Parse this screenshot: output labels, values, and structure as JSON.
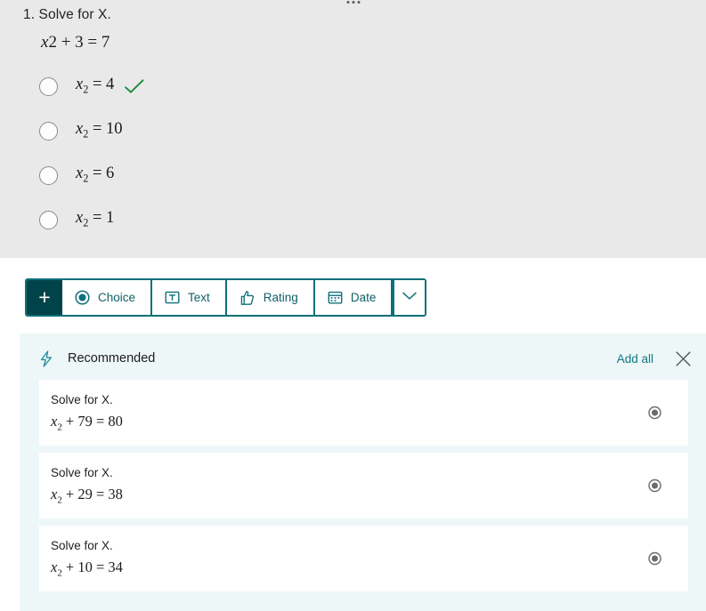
{
  "theme": {
    "accent_teal": "#0f7079",
    "accent_dark_teal": "#00444a",
    "link_teal": "#107885",
    "panel_grey": "#e9e9e9",
    "recommend_bg": "#eef7f8",
    "correct_green": "#1f8a3b"
  },
  "question": {
    "drag_handle_icon": "ellipsis-horizontal-icon",
    "number_and_title": "1. Solve for X.",
    "equation": {
      "variable": "x",
      "variable_suffix": "2",
      "rest": " + 3 = 7",
      "full_text": "x2 + 3 = 7"
    },
    "options": [
      {
        "variable": "x",
        "subscript": "2",
        "rest": " = 4",
        "full_text": "x2 = 4",
        "correct": true,
        "radio_icon": "radio-unchecked-icon",
        "check_icon": "checkmark-icon"
      },
      {
        "variable": "x",
        "subscript": "2",
        "rest": " = 10",
        "full_text": "x2 = 10",
        "correct": false,
        "radio_icon": "radio-unchecked-icon"
      },
      {
        "variable": "x",
        "subscript": "2",
        "rest": " = 6",
        "full_text": "x2 = 6",
        "correct": false,
        "radio_icon": "radio-unchecked-icon"
      },
      {
        "variable": "x",
        "subscript": "2",
        "rest": " = 1",
        "full_text": "x2 = 1",
        "correct": false,
        "radio_icon": "radio-unchecked-icon"
      }
    ]
  },
  "toolbar": {
    "add_label": "+",
    "add_icon": "plus-icon",
    "items": [
      {
        "label": "Choice",
        "icon": "radio-checked-icon"
      },
      {
        "label": "Text",
        "icon": "text-box-t-icon"
      },
      {
        "label": "Rating",
        "icon": "thumbs-up-icon"
      },
      {
        "label": "Date",
        "icon": "calendar-icon"
      }
    ],
    "more_icon": "chevron-down-icon"
  },
  "recommended": {
    "icon": "lightning-bolt-icon",
    "title": "Recommended",
    "add_all_label": "Add all",
    "close_icon": "close-x-icon",
    "cards": [
      {
        "title": "Solve for X.",
        "variable": "x",
        "subscript": "2",
        "rest": " + 79 = 80",
        "equation_text": "x2 + 79 = 80",
        "type_icon": "radio-checked-grey-icon"
      },
      {
        "title": "Solve for X.",
        "variable": "x",
        "subscript": "2",
        "rest": " + 29 = 38",
        "equation_text": "x2 + 29 = 38",
        "type_icon": "radio-checked-grey-icon"
      },
      {
        "title": "Solve for X.",
        "variable": "x",
        "subscript": "2",
        "rest": " + 10 = 34",
        "equation_text": "x2 + 10 = 34",
        "type_icon": "radio-checked-grey-icon"
      }
    ]
  }
}
